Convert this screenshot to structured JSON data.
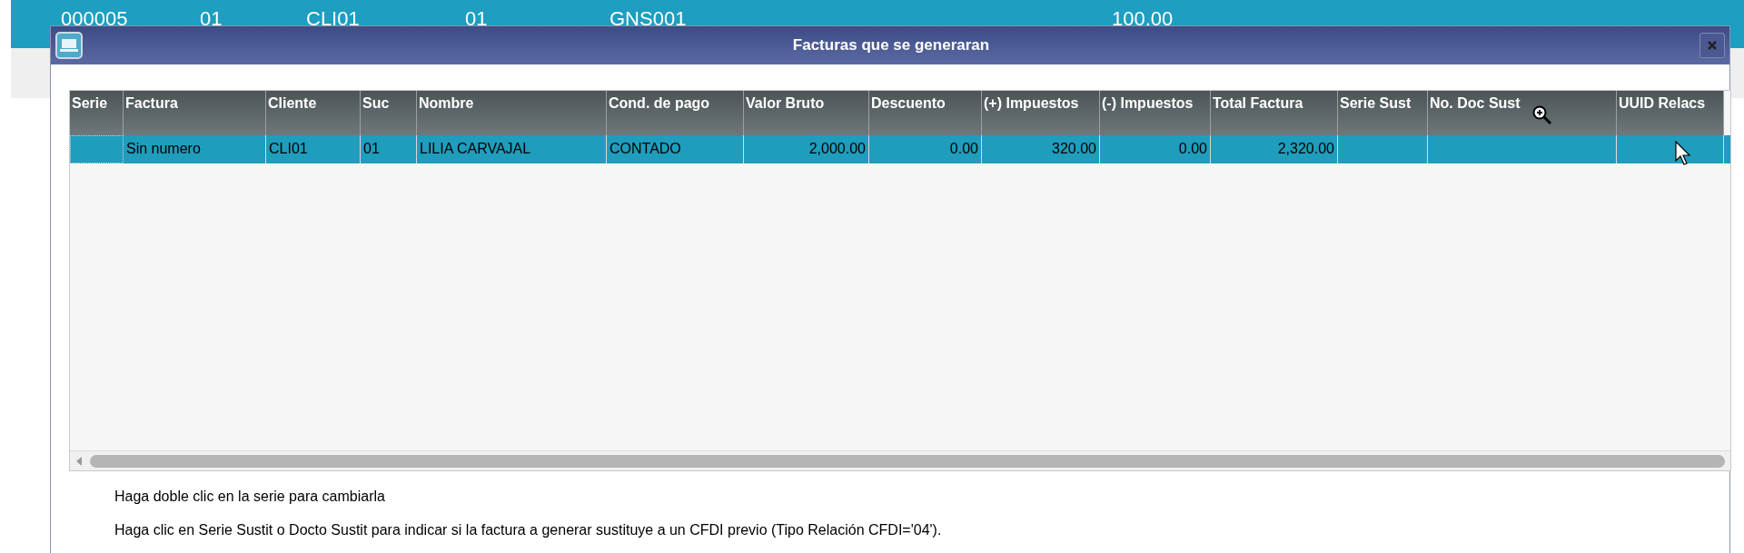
{
  "background_row": {
    "cells": [
      "000005",
      "01",
      "CLI01",
      "01",
      "GNS001",
      "100.00"
    ]
  },
  "dialog": {
    "title": "Facturas que se generaran",
    "table": {
      "columns": [
        "Serie",
        "Factura",
        "Cliente",
        "Suc",
        "Nombre",
        "Cond. de pago",
        "Valor Bruto",
        "Descuento",
        "(+) Impuestos",
        "(-) Impuestos",
        "Total Factura",
        "Serie Sust",
        "No. Doc Sust",
        "UUID Relacs"
      ],
      "rows": [
        {
          "selected": true,
          "cells": [
            "",
            "Sin numero",
            "CLI01",
            "01",
            "LILIA CARVAJAL",
            "CONTADO",
            "2,000.00",
            "0.00",
            "320.00",
            "0.00",
            "2,320.00",
            "",
            "",
            ""
          ]
        }
      ]
    },
    "notes": [
      "Haga doble clic en la serie para cambiarla",
      "Haga clic en Serie Sustit o Docto Sustit para indicar si la factura a generar sustituye a un CFDI previo (Tipo Relación CFDI='04')."
    ]
  }
}
